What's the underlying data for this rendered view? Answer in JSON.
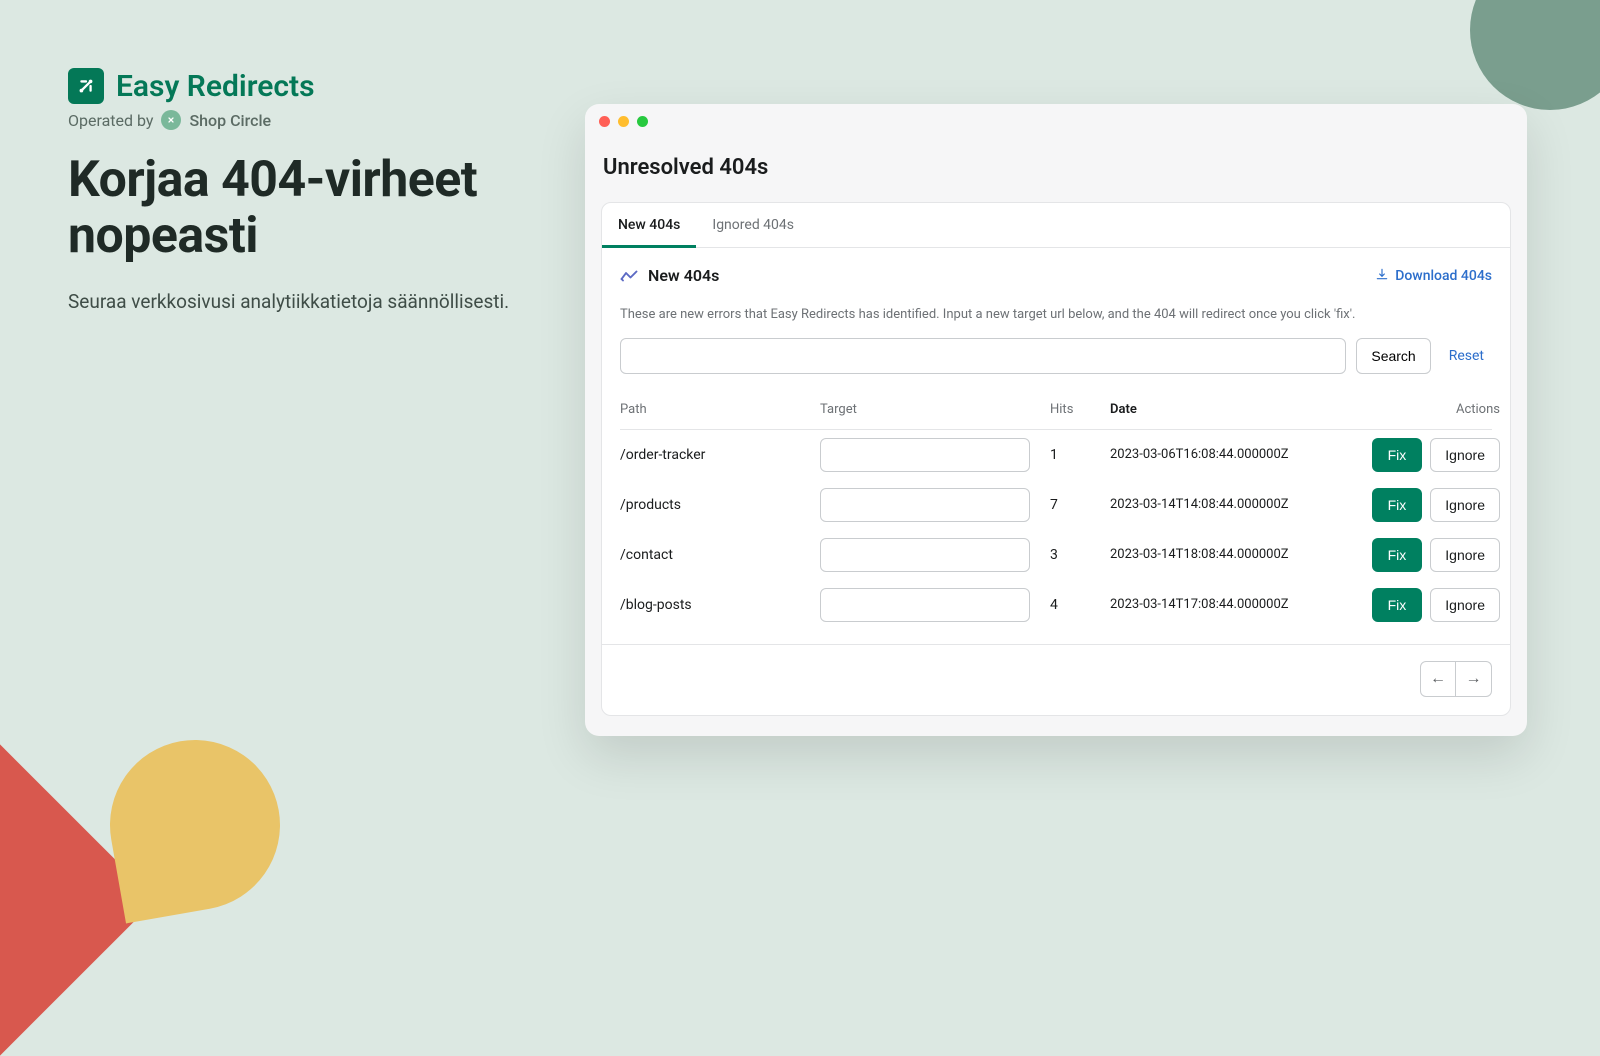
{
  "brand": {
    "name": "Easy Redirects",
    "operated_prefix": "Operated by",
    "operator": "Shop Circle"
  },
  "marketing": {
    "headline": "Korjaa 404-virheet nopeasti",
    "subhead": "Seuraa verkkosivusi analytiikkatietoja säännöllisesti."
  },
  "app": {
    "title": "Unresolved 404s",
    "tabs": [
      {
        "label": "New 404s",
        "active": true
      },
      {
        "label": "Ignored 404s",
        "active": false
      }
    ],
    "section": {
      "title": "New 404s",
      "download": "Download 404s",
      "description": "These are new errors that Easy Redirects has identified. Input a new target url below, and the 404 will redirect once you click 'fix'."
    },
    "search": {
      "value": "",
      "button": "Search",
      "reset": "Reset"
    },
    "columns": {
      "path": "Path",
      "target": "Target",
      "hits": "Hits",
      "date": "Date",
      "actions": "Actions"
    },
    "fix_label": "Fix",
    "ignore_label": "Ignore",
    "rows": [
      {
        "path": "/order-tracker",
        "target": "",
        "hits": "1",
        "date": "2023-03-06T16:08:44.000000Z"
      },
      {
        "path": "/products",
        "target": "",
        "hits": "7",
        "date": "2023-03-14T14:08:44.000000Z"
      },
      {
        "path": "/contact",
        "target": "",
        "hits": "3",
        "date": "2023-03-14T18:08:44.000000Z"
      },
      {
        "path": "/blog-posts",
        "target": "",
        "hits": "4",
        "date": "2023-03-14T17:08:44.000000Z"
      }
    ],
    "pager": {
      "prev": "←",
      "next": "→"
    }
  }
}
